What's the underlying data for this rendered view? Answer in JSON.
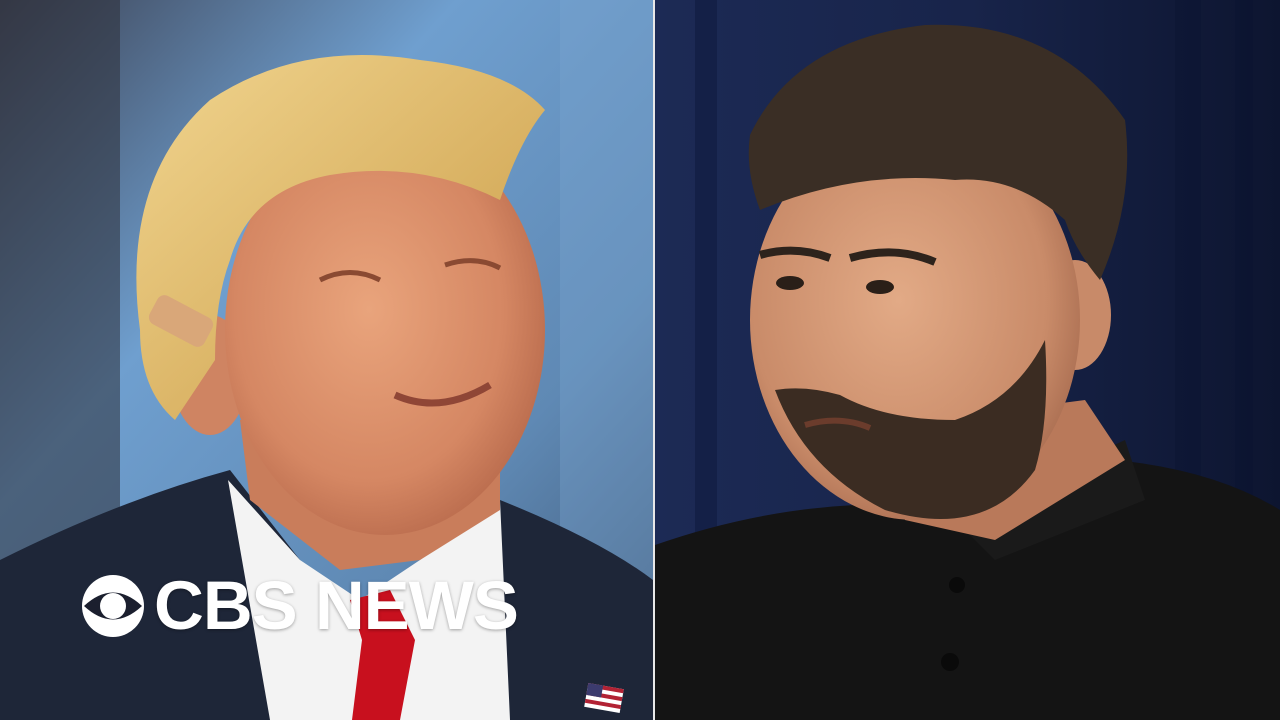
{
  "brand": {
    "name": "CBS NEWS",
    "logo_icon": "cbs-eye-icon",
    "text_color": "#ffffff"
  },
  "left_photo": {
    "background_colors": [
      "#6f9fcf",
      "#3d5573"
    ],
    "suit_color": "#1e2638",
    "tie_color": "#c8101e",
    "hair_color": "#e3bd6a",
    "pin_icon": "american-flag-pin-icon"
  },
  "right_photo": {
    "background_colors": [
      "#1c2a55",
      "#0d1530"
    ],
    "shirt_color": "#141414",
    "hair_color": "#3a2e25"
  }
}
